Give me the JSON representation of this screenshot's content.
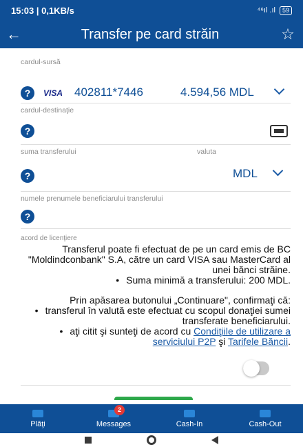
{
  "status_bar": {
    "time": "15:03 | 0,1KB/s",
    "signal": "⁴⁶ıl .ıl",
    "battery": "59"
  },
  "header": {
    "title": "Transfer pe card străin"
  },
  "source_card": {
    "label": "cardul-sursă",
    "brand": "VISA",
    "number": "402811*7446",
    "balance": "4.594,56 MDL"
  },
  "destination_card": {
    "label": "cardul-destinaţie"
  },
  "amount": {
    "label": "suma transferului",
    "currency_label": "valuta",
    "currency_value": "MDL"
  },
  "beneficiary": {
    "label": "numele prenumele beneficiarului transferului"
  },
  "license": {
    "label": "acord de licenţiere",
    "text_1": "Transferul poate fi efectuat de pe un card emis de BC \"Moldindconbank\" S.A, către un card VISA sau MasterCard al unei bănci străine.",
    "bullet_1": "Suma minimă a transferului: 200 MDL.",
    "text_2": "Prin apăsarea butonului „Continuare\", confirmaţi că:",
    "bullet_2": "transferul în valută este efectuat cu scopul donaţiei sumei transferate beneficiarului.",
    "bullet_3_prefix": "aţi citit şi sunteţi de acord cu ",
    "bullet_3_link1": "Condiţiile de utilizare a serviciului P2P",
    "bullet_3_and": " şi ",
    "bullet_3_link2": "Tarifele Băncii",
    "bullet_3_suffix": "."
  },
  "agreement_toggle": {
    "checked": false
  },
  "tabs": [
    {
      "label": "Plăţi",
      "icon": "wallet-icon"
    },
    {
      "label": "Messages",
      "icon": "mail-icon",
      "badge": "2"
    },
    {
      "label": "Cash-In",
      "icon": "atm-in-icon"
    },
    {
      "label": "Cash-Out",
      "icon": "atm-out-icon"
    }
  ]
}
